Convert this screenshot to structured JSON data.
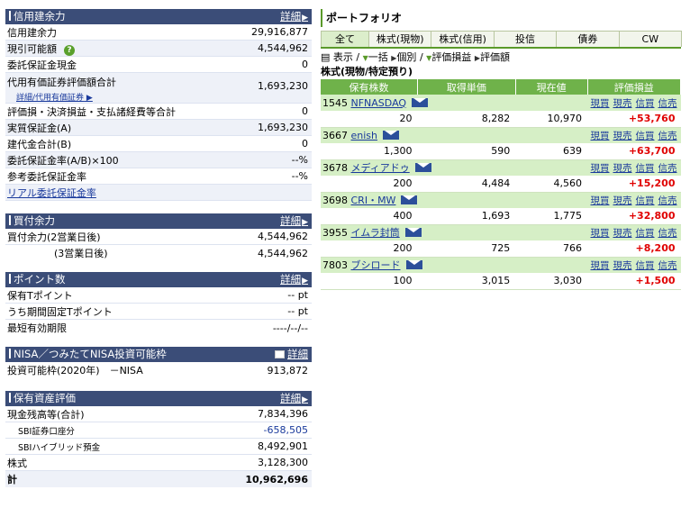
{
  "margin": {
    "title": "信用建余力",
    "detail": "詳細",
    "rows": [
      {
        "label": "信用建余力",
        "value": "29,916,877"
      },
      {
        "label": "現引可能額",
        "value": "4,544,962"
      },
      {
        "label": "委託保証金現金",
        "value": "0"
      },
      {
        "label": "代用有価証券評価額合計",
        "value": "1,693,230",
        "sub": "詳細/代用有価証券"
      },
      {
        "label": "評価損・決済損益・支払諸経費等合計",
        "value": "0"
      },
      {
        "label": "実質保証金(A)",
        "value": "1,693,230"
      },
      {
        "label": "建代金合計(B)",
        "value": "0"
      },
      {
        "label": "委託保証金率(A/B)×100",
        "value": "--%"
      },
      {
        "label": "参考委託保証金率",
        "value": "--%"
      }
    ],
    "link": "リアル委託保証金率"
  },
  "buying": {
    "title": "買付余力",
    "detail": "詳細",
    "rows": [
      {
        "label": "買付余力(2営業日後)",
        "value": "4,544,962"
      },
      {
        "label": "(3営業日後)",
        "value": "4,544,962"
      }
    ]
  },
  "points": {
    "title": "ポイント数",
    "detail": "詳細",
    "rows": [
      {
        "label": "保有Tポイント",
        "value": "-- pt"
      },
      {
        "label": "うち期間固定Tポイント",
        "value": "-- pt"
      },
      {
        "label": "最短有効期限",
        "value": "----/--/--"
      }
    ]
  },
  "nisa": {
    "title": "NISA／つみたてNISA投資可能枠",
    "detail": "詳細",
    "label": "投資可能枠(2020年)　－NISA",
    "value": "913,872"
  },
  "assets": {
    "title": "保有資産評価",
    "detail": "詳細",
    "rows": [
      {
        "label": "現金残高等(合計)",
        "value": "7,834,396"
      },
      {
        "label": "SBI証券口座分",
        "value": "-658,505"
      },
      {
        "label": "SBIハイブリッド預金",
        "value": "8,492,901"
      },
      {
        "label": "株式",
        "value": "3,128,300"
      },
      {
        "label": "計",
        "value": "10,962,696"
      }
    ]
  },
  "portfolio": {
    "title": "ポートフォリオ",
    "tabs": [
      "全て",
      "株式(現物)",
      "株式(信用)",
      "投信",
      "債券",
      "CW"
    ],
    "options": {
      "display": "表示",
      "sep": "/",
      "bulk": "一括",
      "individual": "個別",
      "pl_sort": "評価損益",
      "valuation": "評価額"
    },
    "section": "株式(現物/特定預り)",
    "columns": [
      "保有株数",
      "取得単価",
      "現在値",
      "評価損益"
    ],
    "actions": [
      "現買",
      "現売",
      "信買",
      "信売"
    ],
    "holdings": [
      {
        "code": "1545",
        "name": "NFNASDAQ",
        "qty": "20",
        "cost": "8,282",
        "price": "10,970",
        "pl": "+53,760"
      },
      {
        "code": "3667",
        "name": "enish",
        "qty": "1,300",
        "cost": "590",
        "price": "639",
        "pl": "+63,700"
      },
      {
        "code": "3678",
        "name": "メディアドゥ",
        "qty": "200",
        "cost": "4,484",
        "price": "4,560",
        "pl": "+15,200"
      },
      {
        "code": "3698",
        "name": "CRI・MW",
        "qty": "400",
        "cost": "1,693",
        "price": "1,775",
        "pl": "+32,800"
      },
      {
        "code": "3955",
        "name": "イムラ封筒",
        "qty": "200",
        "cost": "725",
        "price": "766",
        "pl": "+8,200"
      },
      {
        "code": "7803",
        "name": "ブシロード",
        "qty": "100",
        "cost": "3,015",
        "price": "3,030",
        "pl": "+1,500"
      }
    ]
  }
}
